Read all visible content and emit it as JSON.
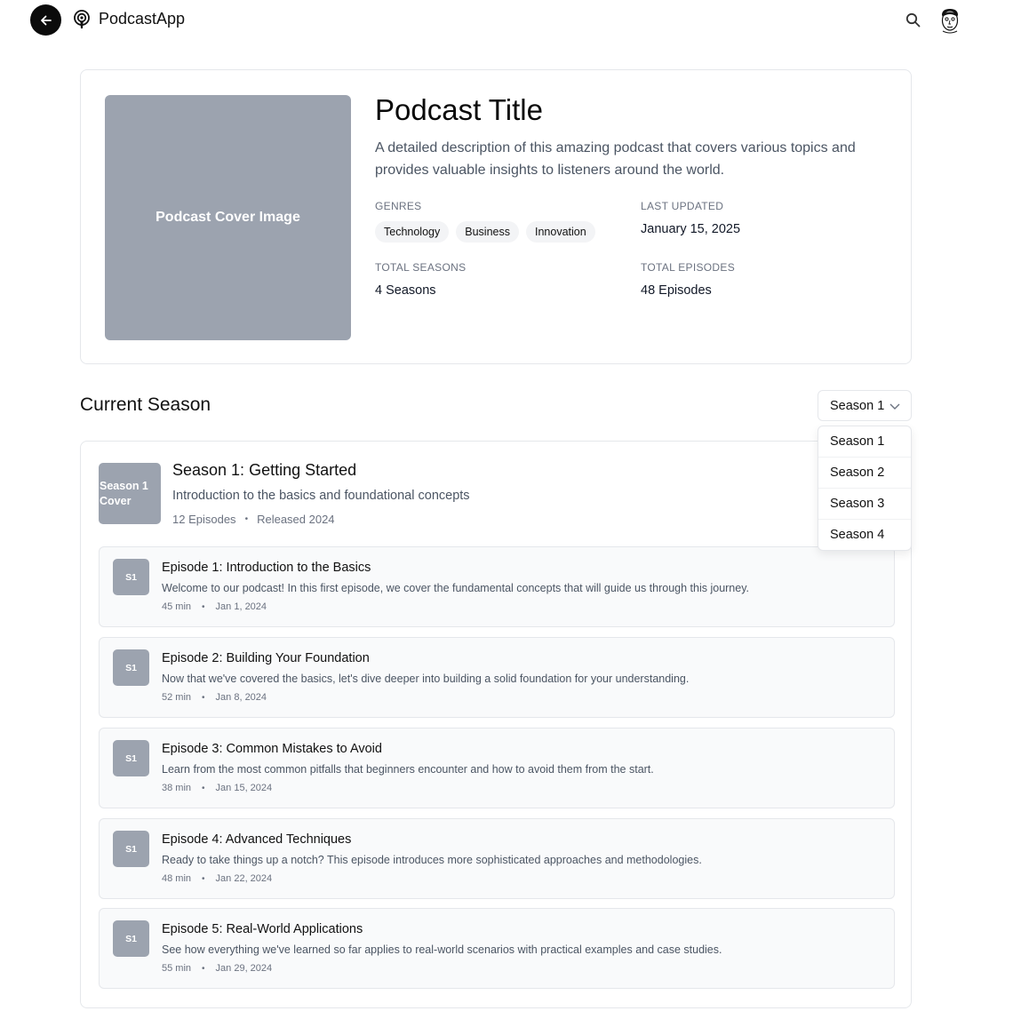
{
  "app": {
    "name": "PodcastApp"
  },
  "icons": {
    "back": "arrow-left-icon",
    "logo": "podcast-icon",
    "search": "search-icon",
    "avatar": "avatar"
  },
  "podcast": {
    "cover_label": "Podcast Cover Image",
    "title": "Podcast Title",
    "description": "A detailed description of this amazing podcast that covers various topics and provides valuable insights to listeners around the world.",
    "genres_label": "GENRES",
    "genres": [
      "Technology",
      "Business",
      "Innovation"
    ],
    "last_updated_label": "LAST UPDATED",
    "last_updated": "January 15, 2025",
    "total_seasons_label": "TOTAL SEASONS",
    "total_seasons": "4 Seasons",
    "total_episodes_label": "TOTAL EPISODES",
    "total_episodes": "48 Episodes"
  },
  "season_section": {
    "heading": "Current Season",
    "selected": "Season 1",
    "options": [
      "Season 1",
      "Season 2",
      "Season 3",
      "Season 4"
    ]
  },
  "season": {
    "cover_label": "Season 1 Cover",
    "title": "Season 1: Getting Started",
    "description": "Introduction to the basics and foundational concepts",
    "episodes_count": "12 Episodes",
    "released": "Released 2024",
    "separator": "•"
  },
  "episodes": [
    {
      "badge": "S1",
      "title": "Episode 1: Introduction to the Basics",
      "description": "Welcome to our podcast! In this first episode, we cover the fundamental concepts that will guide us through this journey.",
      "duration": "45 min",
      "date": "Jan 1, 2024"
    },
    {
      "badge": "S1",
      "title": "Episode 2: Building Your Foundation",
      "description": "Now that we've covered the basics, let's dive deeper into building a solid foundation for your understanding.",
      "duration": "52 min",
      "date": "Jan 8, 2024"
    },
    {
      "badge": "S1",
      "title": "Episode 3: Common Mistakes to Avoid",
      "description": "Learn from the most common pitfalls that beginners encounter and how to avoid them from the start.",
      "duration": "38 min",
      "date": "Jan 15, 2024"
    },
    {
      "badge": "S1",
      "title": "Episode 4: Advanced Techniques",
      "description": "Ready to take things up a notch? This episode introduces more sophisticated approaches and methodologies.",
      "duration": "48 min",
      "date": "Jan 22, 2024"
    },
    {
      "badge": "S1",
      "title": "Episode 5: Real-World Applications",
      "description": "See how everything we've learned so far applies to real-world scenarios with practical examples and case studies.",
      "duration": "55 min",
      "date": "Jan 29, 2024"
    }
  ]
}
